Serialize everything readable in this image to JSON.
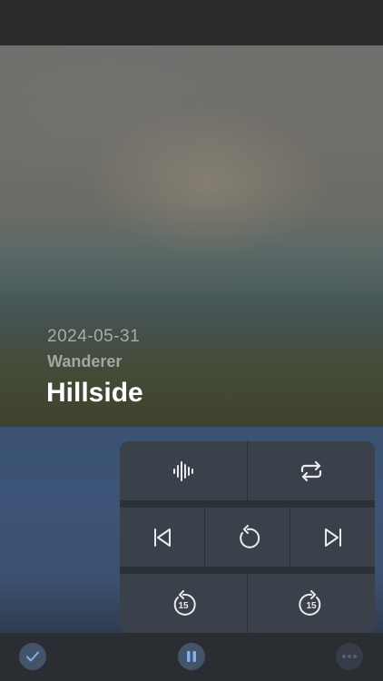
{
  "track": {
    "date": "2024-05-31",
    "artist": "Wanderer",
    "title": "Hillside"
  },
  "controls": {
    "row1": [
      "waveform-icon",
      "repeat-icon"
    ],
    "row2": [
      "skip-previous-icon",
      "replay-icon",
      "skip-next-icon"
    ],
    "row3": [
      {
        "icon": "skip-back-15-icon",
        "label": "15"
      },
      {
        "icon": "skip-forward-15-icon",
        "label": "15"
      }
    ]
  },
  "bottom_bar": {
    "left": "checkmark-icon",
    "center": "pause-icon",
    "right": "more-options-icon"
  },
  "colors": {
    "accent": "#7fb0f0",
    "panel": "#3b414a",
    "title_text": "#ffffff"
  }
}
